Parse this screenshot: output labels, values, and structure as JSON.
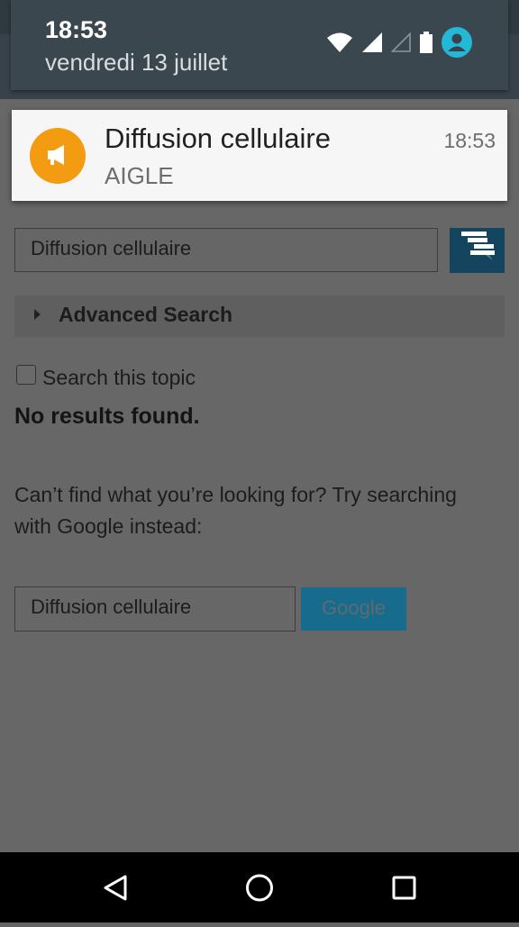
{
  "status": {
    "time": "18:53",
    "date": "vendredi 13 juillet",
    "icons": [
      "wifi-icon",
      "signal-icon",
      "signal-empty-icon",
      "battery-icon",
      "account-icon"
    ]
  },
  "notification": {
    "title": "Diffusion cellulaire",
    "subtitle": "AIGLE",
    "time": "18:53",
    "icon": "megaphone-icon",
    "icon_color": "#f39c12"
  },
  "search": {
    "value": "Diffusion cellulaire",
    "button_icon": "search-icon"
  },
  "advanced_search": {
    "label": "Advanced Search"
  },
  "search_topic": {
    "label": "Search this topic",
    "checked": false
  },
  "results": {
    "message": "No results found."
  },
  "google": {
    "prompt": "Can’t find what you’re looking for? Try searching with Google instead:",
    "value": "Diffusion cellulaire",
    "button_label": "Google"
  },
  "navbar": {
    "buttons": [
      "back-icon",
      "home-icon",
      "recents-icon"
    ]
  }
}
